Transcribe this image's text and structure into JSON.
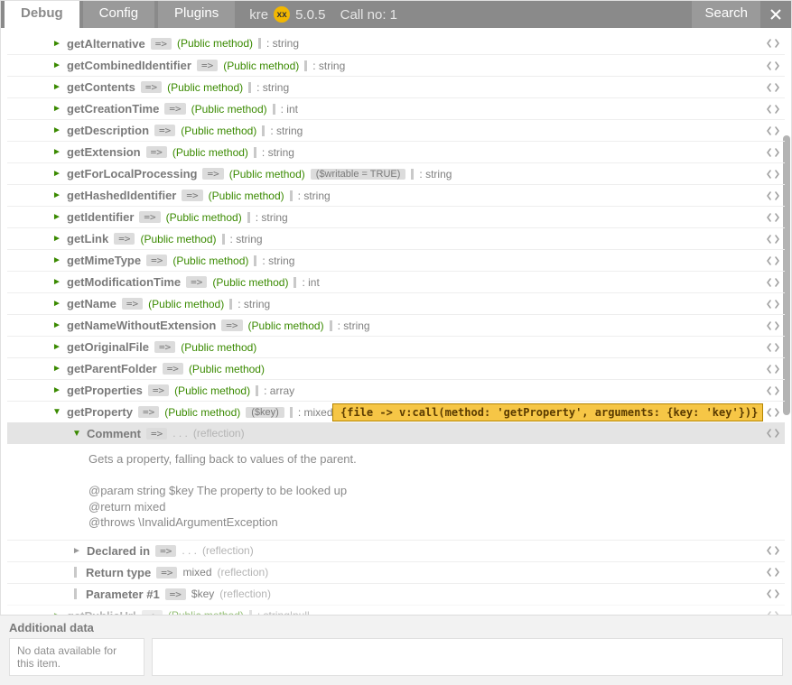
{
  "header": {
    "tabs": [
      "Debug",
      "Config",
      "Plugins"
    ],
    "active_tab": 0,
    "brand": "kre",
    "logo_text": "xx",
    "version": "5.0.5",
    "call_label": "Call no: 1",
    "search_label": "Search"
  },
  "const": {
    "arrow": "=>",
    "public": "(Public method)",
    "dots": ". . .",
    "reflection": "(reflection)"
  },
  "rows": [
    {
      "name": "getAlternative",
      "ret": ": string",
      "variant": "<fluid>"
    },
    {
      "name": "getCombinedIdentifier",
      "ret": ": string",
      "variant": "<fluid>"
    },
    {
      "name": "getContents",
      "ret": ": string",
      "variant": "<fluid>"
    },
    {
      "name": "getCreationTime",
      "ret": ": int",
      "variant": "<fluid>"
    },
    {
      "name": "getDescription",
      "ret": ": string",
      "variant": "<fluid>"
    },
    {
      "name": "getExtension",
      "ret": ": string",
      "variant": "<fluid>"
    },
    {
      "name": "getForLocalProcessing",
      "param": "($writable = TRUE)",
      "ret": ": string",
      "variant": "<fluid>"
    },
    {
      "name": "getHashedIdentifier",
      "ret": ": string",
      "variant": "<fluid>"
    },
    {
      "name": "getIdentifier",
      "ret": ": string",
      "variant": "<fluid>"
    },
    {
      "name": "getLink",
      "ret": ": string",
      "variant": "<fluid>"
    },
    {
      "name": "getMimeType",
      "ret": ": string",
      "variant": "<fluid>"
    },
    {
      "name": "getModificationTime",
      "ret": ": int",
      "variant": "<fluid>"
    },
    {
      "name": "getName",
      "ret": ": string",
      "variant": "<fluid>"
    },
    {
      "name": "getNameWithoutExtension",
      "ret": ": string",
      "variant": "<fluid>"
    },
    {
      "name": "getOriginalFile",
      "variant": "<fluid>"
    },
    {
      "name": "getParentFolder",
      "variant": "<fluid>"
    },
    {
      "name": "getProperties",
      "ret": ": array",
      "variant": "<fluid>"
    },
    {
      "name": "getProperty",
      "param": "($key)",
      "ret": ": mixed",
      "variant": "<fluid>",
      "expanded": true,
      "tooltip": "{file -> v:call(method: 'getProperty', arguments: {key: 'key'})}"
    }
  ],
  "expanded_detail": {
    "comment": {
      "label": "Comment",
      "body": "Gets a property, falling back to values of the parent.\n\n@param string $key The property to be looked up\n@return mixed\n@throws \\InvalidArgumentException"
    },
    "declared_in": {
      "label": "Declared in"
    },
    "return_type": {
      "label": "Return type",
      "value": "mixed"
    },
    "param1": {
      "label": "Parameter #1",
      "value": "$key"
    }
  },
  "tail_row": {
    "name": "getPublicUrl",
    "ret": ": string|null",
    "variant": "<fluid>"
  },
  "footer": {
    "title": "Additional data",
    "left_text": "No data available for this item."
  }
}
